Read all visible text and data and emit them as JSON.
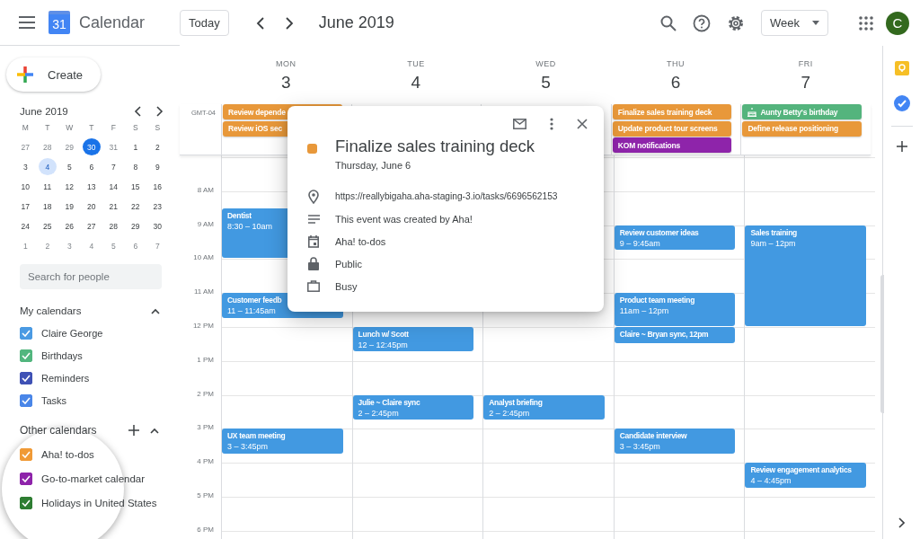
{
  "header": {
    "logo_day": "31",
    "app_name": "Calendar",
    "today_button": "Today",
    "period": "June 2019",
    "view": "Week",
    "avatar_initial": "C"
  },
  "sidebar": {
    "create_button": "Create",
    "mini_calendar": {
      "title": "June 2019",
      "weekdays": [
        "M",
        "T",
        "W",
        "T",
        "F",
        "S",
        "S"
      ],
      "days": [
        {
          "label": "27",
          "muted": true,
          "today": false,
          "selected": false
        },
        {
          "label": "28",
          "muted": true,
          "today": false,
          "selected": false
        },
        {
          "label": "29",
          "muted": true,
          "today": false,
          "selected": false
        },
        {
          "label": "30",
          "muted": true,
          "today": true,
          "selected": false
        },
        {
          "label": "31",
          "muted": true,
          "today": false,
          "selected": false
        },
        {
          "label": "1",
          "muted": false,
          "today": false,
          "selected": false
        },
        {
          "label": "2",
          "muted": false,
          "today": false,
          "selected": false
        },
        {
          "label": "3",
          "muted": false,
          "today": false,
          "selected": false
        },
        {
          "label": "4",
          "muted": false,
          "today": false,
          "selected": true
        },
        {
          "label": "5",
          "muted": false,
          "today": false,
          "selected": false
        },
        {
          "label": "6",
          "muted": false,
          "today": false,
          "selected": false
        },
        {
          "label": "7",
          "muted": false,
          "today": false,
          "selected": false
        },
        {
          "label": "8",
          "muted": false,
          "today": false,
          "selected": false
        },
        {
          "label": "9",
          "muted": false,
          "today": false,
          "selected": false
        },
        {
          "label": "10",
          "muted": false,
          "today": false,
          "selected": false
        },
        {
          "label": "11",
          "muted": false,
          "today": false,
          "selected": false
        },
        {
          "label": "12",
          "muted": false,
          "today": false,
          "selected": false
        },
        {
          "label": "13",
          "muted": false,
          "today": false,
          "selected": false
        },
        {
          "label": "14",
          "muted": false,
          "today": false,
          "selected": false
        },
        {
          "label": "15",
          "muted": false,
          "today": false,
          "selected": false
        },
        {
          "label": "16",
          "muted": false,
          "today": false,
          "selected": false
        },
        {
          "label": "17",
          "muted": false,
          "today": false,
          "selected": false
        },
        {
          "label": "18",
          "muted": false,
          "today": false,
          "selected": false
        },
        {
          "label": "19",
          "muted": false,
          "today": false,
          "selected": false
        },
        {
          "label": "20",
          "muted": false,
          "today": false,
          "selected": false
        },
        {
          "label": "21",
          "muted": false,
          "today": false,
          "selected": false
        },
        {
          "label": "22",
          "muted": false,
          "today": false,
          "selected": false
        },
        {
          "label": "23",
          "muted": false,
          "today": false,
          "selected": false
        },
        {
          "label": "24",
          "muted": false,
          "today": false,
          "selected": false
        },
        {
          "label": "25",
          "muted": false,
          "today": false,
          "selected": false
        },
        {
          "label": "26",
          "muted": false,
          "today": false,
          "selected": false
        },
        {
          "label": "27",
          "muted": false,
          "today": false,
          "selected": false
        },
        {
          "label": "28",
          "muted": false,
          "today": false,
          "selected": false
        },
        {
          "label": "29",
          "muted": false,
          "today": false,
          "selected": false
        },
        {
          "label": "30",
          "muted": false,
          "today": false,
          "selected": false
        },
        {
          "label": "1",
          "muted": true,
          "today": false,
          "selected": false
        },
        {
          "label": "2",
          "muted": true,
          "today": false,
          "selected": false
        },
        {
          "label": "3",
          "muted": true,
          "today": false,
          "selected": false
        },
        {
          "label": "4",
          "muted": true,
          "today": false,
          "selected": false
        },
        {
          "label": "5",
          "muted": true,
          "today": false,
          "selected": false
        },
        {
          "label": "6",
          "muted": true,
          "today": false,
          "selected": false
        },
        {
          "label": "7",
          "muted": true,
          "today": false,
          "selected": false
        }
      ]
    },
    "search": {
      "placeholder": "Search for people"
    },
    "my_calendars": {
      "title": "My calendars",
      "expanded": true,
      "items": [
        {
          "name": "Claire George",
          "color": "#4a9ae3",
          "checked": true
        },
        {
          "name": "Birthdays",
          "color": "#52b67e",
          "checked": true
        },
        {
          "name": "Reminders",
          "color": "#3f51b5",
          "checked": true
        },
        {
          "name": "Tasks",
          "color": "#4a86e8",
          "checked": true
        }
      ]
    },
    "other_calendars": {
      "title": "Other calendars",
      "expanded": true,
      "items": [
        {
          "name": "Aha! to-dos",
          "color": "#f09a36",
          "checked": true
        },
        {
          "name": "Go-to-market calendar",
          "color": "#8e24aa",
          "checked": true
        },
        {
          "name": "Holidays in United States",
          "color": "#2e7d32",
          "checked": true
        }
      ]
    }
  },
  "week": {
    "timezone": "GMT-04",
    "hours": [
      "8 AM",
      "9 AM",
      "10 AM",
      "11 AM",
      "12 PM",
      "1 PM",
      "2 PM",
      "3 PM",
      "4 PM",
      "5 PM",
      "6 PM"
    ],
    "days": [
      {
        "weekday": "MON",
        "date": "3",
        "all_day": [
          {
            "title": "Review depende",
            "color": "#e8983a",
            "kind": "task"
          },
          {
            "title": "Review iOS sec",
            "color": "#e8983a",
            "kind": "task"
          }
        ],
        "events": [
          {
            "title": "Dentist",
            "time": "8:30 – 10am"
          },
          {
            "title": "Customer feedb",
            "time": "11 – 11:45am"
          },
          {
            "title": "UX team meeting",
            "time": "3 – 3:45pm"
          }
        ]
      },
      {
        "weekday": "TUE",
        "date": "4",
        "events": [
          {
            "title": "Lunch w/ Scott",
            "time": "12 – 12:45pm"
          },
          {
            "title": "Julie ~ Claire sync",
            "time": "2 – 2:45pm"
          }
        ]
      },
      {
        "weekday": "WED",
        "date": "5",
        "events": [
          {
            "title": "Analyst briefing",
            "time": "2 – 2:45pm"
          }
        ]
      },
      {
        "weekday": "THU",
        "date": "6",
        "all_day": [
          {
            "title": "Finalize sales training deck",
            "color": "#e8983a",
            "kind": "task"
          },
          {
            "title": "Update product tour screens",
            "color": "#e8983a",
            "kind": "task"
          },
          {
            "title": "KOM notifications",
            "color": "#8e24aa",
            "kind": "task"
          }
        ],
        "events": [
          {
            "title": "Review customer ideas",
            "time": "9 – 9:45am"
          },
          {
            "title": "Product team meeting",
            "time": "11am – 12pm"
          },
          {
            "title": "Claire ~ Bryan sync, 12pm"
          },
          {
            "title": "Candidate interview",
            "time": "3 – 3:45pm"
          }
        ]
      },
      {
        "weekday": "FRI",
        "date": "7",
        "all_day": [
          {
            "title": "Aunty Betty's birthday",
            "color": "#54b47d",
            "kind": "birthday"
          },
          {
            "title": "Define release positioning",
            "color": "#e8983a",
            "kind": "task"
          }
        ],
        "events": [
          {
            "title": "Sales training",
            "time": "9am – 12pm"
          },
          {
            "title": "Review engagement analytics",
            "time": "4 – 4:45pm"
          }
        ]
      }
    ]
  },
  "popup": {
    "title": "Finalize sales training deck",
    "color": "#e8983a",
    "date": "Thursday, June 6",
    "details": [
      {
        "kind": "location",
        "text": "https://reallybigaha.aha-staging-3.io/tasks/6696562153"
      },
      {
        "kind": "description",
        "text": "This event was created by Aha!"
      },
      {
        "kind": "calendar",
        "text": "Aha! to-dos"
      },
      {
        "kind": "visibility",
        "text": "Public"
      },
      {
        "kind": "availability",
        "text": "Busy"
      }
    ]
  }
}
